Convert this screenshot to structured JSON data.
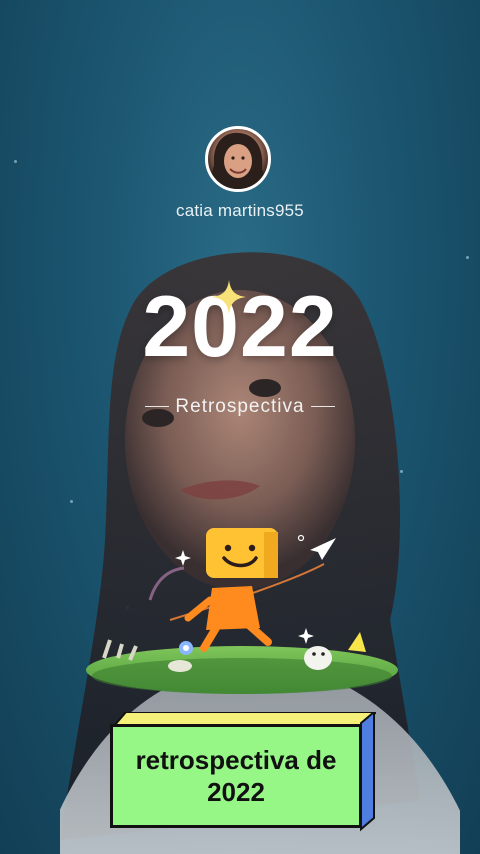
{
  "profile": {
    "username": "catia martins955",
    "avatar_icon": "profile-photo"
  },
  "hero": {
    "year": "2022",
    "subtitle": "Retrospectiva"
  },
  "caption": {
    "text": "retrospectiva de\n2022",
    "background": "#96f686",
    "top_color": "#f4f07a",
    "side_color": "#4f7de0"
  },
  "colors": {
    "background": "#1b5570",
    "text": "#ffffff",
    "accent_star": "#f7e27a"
  },
  "decorations": {
    "mascot_icon": "smiley-box-mascot-icon",
    "paper_plane_icon": "paper-plane-icon",
    "sparkle_icon": "sparkle-icon"
  }
}
